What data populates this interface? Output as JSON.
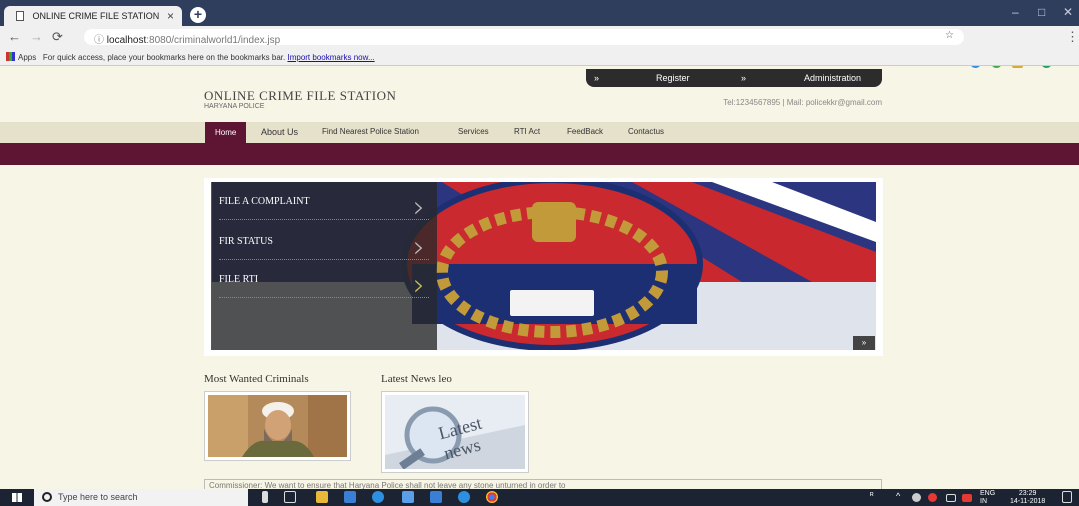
{
  "browser": {
    "tab_title": "ONLINE CRIME FILE STATION",
    "tab_close": "×",
    "new_tab": "+",
    "url_host": "localhost",
    "url_rest": ":8080/criminalworld1/index.jsp",
    "bookmarks_apps": "Apps",
    "bookmarks_hint": "For quick access, place your bookmarks here on the bookmarks bar.",
    "bookmarks_import": "Import bookmarks now..."
  },
  "header": {
    "register": "Register",
    "administration": "Administration",
    "arrow": "»",
    "site_title": "ONLINE CRIME FILE STATION",
    "site_subtitle": "HARYANA POLICE",
    "contact": "Tel:1234567895 | Mail: policekkr@gmail.com"
  },
  "menu": {
    "items": [
      "Home",
      "About Us",
      "Find Nearest Police Station",
      "Services",
      "RTI Act",
      "FeedBack",
      "Contactus"
    ]
  },
  "slider": {
    "links": [
      "FILE A COMPLAINT",
      "FIR STATUS",
      "FILE RTI"
    ],
    "next": "»"
  },
  "sections": {
    "wanted": "Most Wanted Criminals",
    "news": "Latest News leo"
  },
  "quote_text": "Commissioner: We want to ensure that Haryana Police shall not leave any stone unturned in order to",
  "taskbar": {
    "search_placeholder": "Type here to search",
    "lang1": "ENG",
    "lang2": "IN",
    "time": "23:29",
    "date": "14-11-2018"
  },
  "colors": {
    "maroon": "#5e1433",
    "page_bg": "#f7f5e6",
    "menu_bg": "#e6e1cb"
  }
}
